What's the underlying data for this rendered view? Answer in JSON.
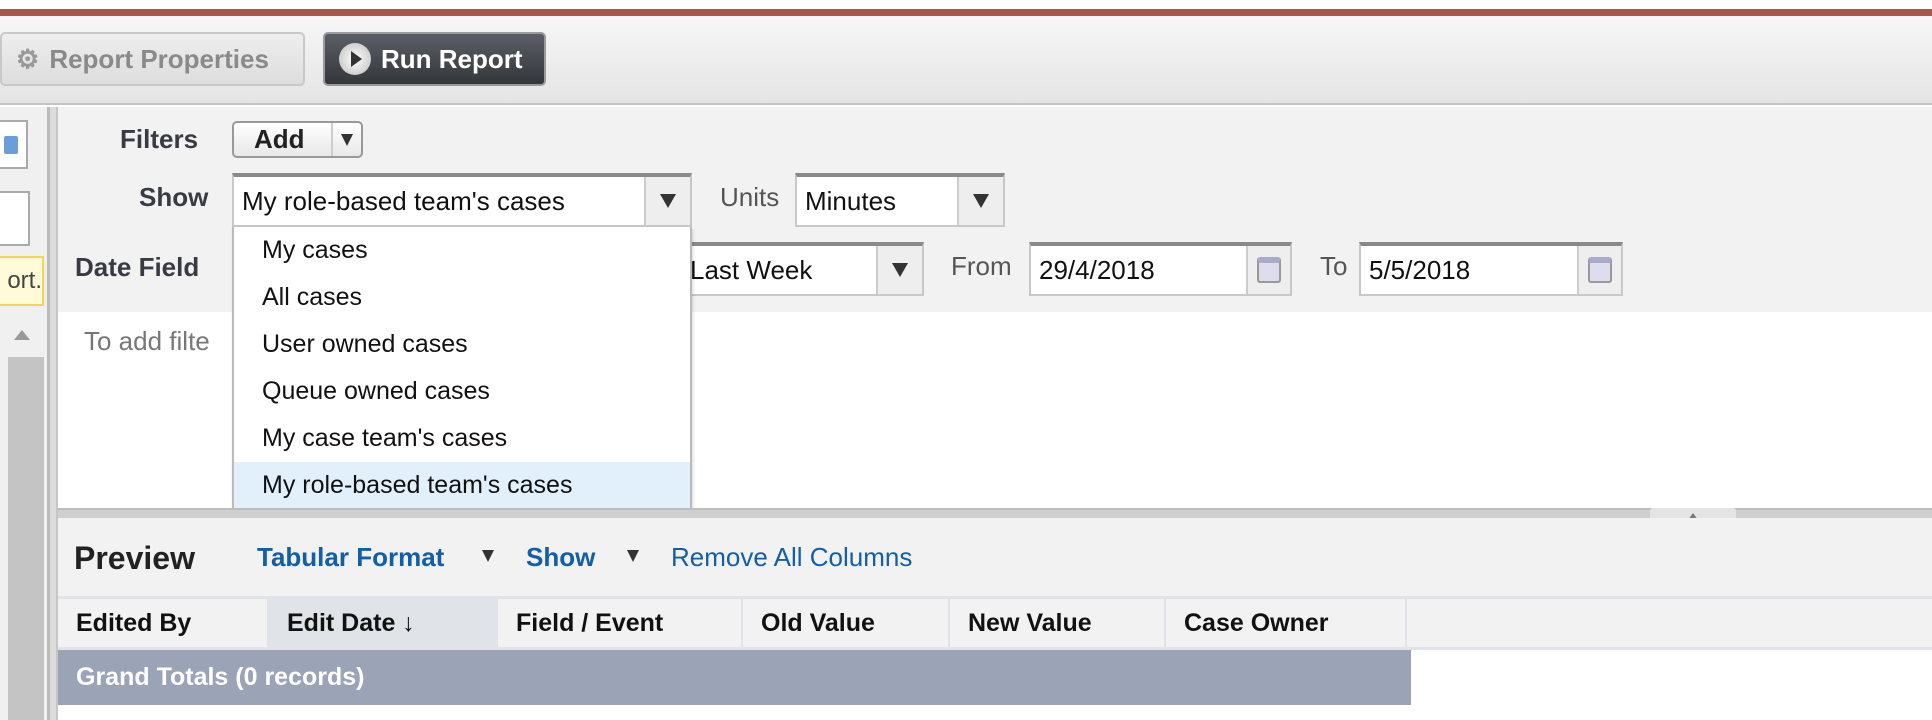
{
  "colors": {
    "top_bar": "#a8584a",
    "grand_totals_bg": "#9ba3b6",
    "link": "#125ea8",
    "highlight": "#e2f0fb"
  },
  "toolbar": {
    "report_properties": "Report Properties",
    "run_report": "Run Report"
  },
  "left_pane": {
    "tooltip_fragment": "ort."
  },
  "filters": {
    "filters_label": "Filters",
    "add_button": "Add",
    "show_label": "Show",
    "show_value": "My role-based team's cases",
    "units_label": "Units",
    "units_value": "Minutes",
    "date_field_label": "Date Field",
    "range_value": "Last Week",
    "from_label": "From",
    "from_value": "29/4/2018",
    "to_label": "To",
    "to_value": "5/5/2018",
    "hint": "To add filte"
  },
  "show_options": [
    "My cases",
    "All cases",
    "User owned cases",
    "Queue owned cases",
    "My case team's cases",
    "My role-based team's cases"
  ],
  "preview": {
    "title": "Preview",
    "format": "Tabular Format",
    "show": "Show",
    "remove_all": "Remove All Columns"
  },
  "table": {
    "columns": [
      "Edited By",
      "Edit Date ↓",
      "Field / Event",
      "Old Value",
      "New Value",
      "Case Owner"
    ],
    "grand_totals": "Grand Totals (0 records)"
  }
}
